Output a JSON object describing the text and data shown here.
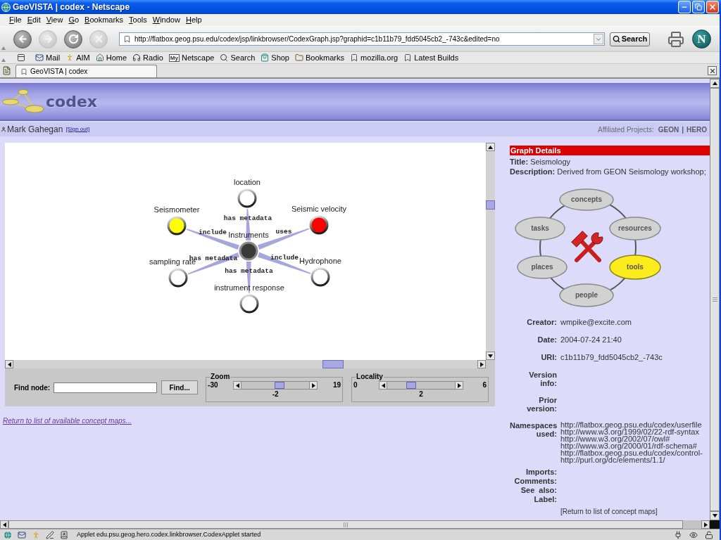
{
  "window": {
    "title": "GeoVISTA | codex - Netscape"
  },
  "menu_bar": [
    "File",
    "Edit",
    "View",
    "Go",
    "Bookmarks",
    "Tools",
    "Window",
    "Help"
  ],
  "navigation_toolbar": {
    "buttons": [
      {
        "kind": "back",
        "disabled": false
      },
      {
        "kind": "forward",
        "disabled": true
      },
      {
        "kind": "reload",
        "disabled": false
      },
      {
        "kind": "stop",
        "disabled": true
      }
    ],
    "url": "http://flatbox.geog.psu.edu/codex/jsp/linkbrowser/CodexGraph.jsp?graphid=c1b11b79_fdd5045cb2_-743c&edited=no",
    "search_button": "Search",
    "logo_letter": "N"
  },
  "bookmarks_toolbar": [
    {
      "kind": "mail",
      "label": "Mail"
    },
    {
      "kind": "aim",
      "label": "AIM"
    },
    {
      "kind": "home",
      "label": "Home"
    },
    {
      "kind": "radio",
      "label": "Radio"
    },
    {
      "kind": "my",
      "badge": "My",
      "label": "Netscape"
    },
    {
      "kind": "search",
      "label": "Search"
    },
    {
      "kind": "shop",
      "label": "Shop"
    },
    {
      "kind": "folder",
      "label": "Bookmarks"
    },
    {
      "kind": "link",
      "label": "mozilla.org"
    },
    {
      "kind": "link",
      "label": "Latest Builds"
    }
  ],
  "tabs": [
    {
      "label": "GeoVISTA | codex",
      "selected": true
    }
  ],
  "page": {
    "logo_text": "codex",
    "user": {
      "name": "Mark Gahegan",
      "sign_out": "[Sign out]"
    },
    "affiliated_projects": {
      "label": "Affiliated Projects:",
      "projects": [
        "GEON",
        "HERO"
      ],
      "separator": "|"
    },
    "applet": {
      "graph": {
        "center": {
          "label": "Instruments",
          "color": "#3a3a3a"
        },
        "neighbors": [
          {
            "label": "location",
            "color": "#ffffff",
            "relation": "has metadata"
          },
          {
            "label": "Seismometer",
            "color": "#ffff00",
            "relation": "include"
          },
          {
            "label": "Seismic velocity",
            "color": "#ff0000",
            "relation": "uses"
          },
          {
            "label": "sampling rate",
            "color": "#ffffff",
            "relation": "has metadata"
          },
          {
            "label": "Hydrophone",
            "color": "#ffffff",
            "relation": "include"
          },
          {
            "label": "instrument response",
            "color": "#ffffff",
            "relation": "has metadata"
          }
        ]
      },
      "find_node": {
        "label": "Find node:",
        "button": "Find..."
      },
      "sliders": [
        {
          "title": "Zoom",
          "min": "-30",
          "max": "19",
          "value": "-2",
          "level": 0.57
        },
        {
          "title": "Locality",
          "min": "0",
          "max": "6",
          "value": "2",
          "level": 0.33
        }
      ]
    },
    "return_link": "Return to list of available concept maps...",
    "graph_details": {
      "heading": "Graph Details",
      "title": {
        "label": "Title:",
        "value": "Seismology"
      },
      "description": {
        "label": "Description:",
        "value": "Derived from GEON Seismology workshop;"
      },
      "facets": [
        {
          "label": "concepts",
          "selected": false
        },
        {
          "label": "tasks",
          "selected": false
        },
        {
          "label": "resources",
          "selected": false
        },
        {
          "label": "places",
          "selected": false
        },
        {
          "label": "tools",
          "selected": true
        },
        {
          "label": "people",
          "selected": false
        }
      ],
      "fields": [
        {
          "label": "Creator:",
          "value": "wmpike@excite.com"
        },
        {
          "label": "Date:",
          "value": "2004-07-24 21:40"
        },
        {
          "label": "URI:",
          "value": "c1b11b79_fdd5045cb2_-743c"
        },
        {
          "label": "Version info:"
        },
        {
          "label": "Prior version:"
        },
        {
          "label": "Namespaces used:",
          "values": [
            "http://flatbox.geog.psu.edu/codex/userfile",
            "http://www.w3.org/1999/02/22-rdf-syntax",
            "http://www.w3.org/2002/07/owl#",
            "http://www.w3.org/2000/01/rdf-schema#",
            "http://flatbox.geog.psu.edu/codex/control-",
            "http://purl.org/dc/elements/1.1/"
          ]
        },
        {
          "label": "Imports:"
        },
        {
          "label": "Comments:"
        },
        {
          "label": "See also:"
        },
        {
          "label": "Label:"
        }
      ],
      "return_link": "[Return to list of concept maps]"
    }
  },
  "status_bar": {
    "text": "Applet edu.psu.geog.hero.codex.linkbrowser.CodexApplet started"
  }
}
